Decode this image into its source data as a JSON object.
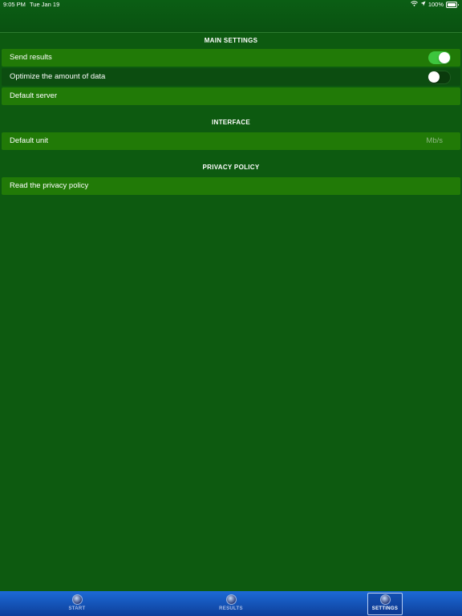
{
  "status_bar": {
    "time": "9:05 PM",
    "date": "Tue Jan 19",
    "battery": "100%"
  },
  "sections": [
    {
      "header": "MAIN SETTINGS",
      "rows": [
        {
          "label": "Send results",
          "toggle": true
        },
        {
          "label": "Optimize the amount of data",
          "toggle": false
        },
        {
          "label": "Default server"
        }
      ]
    },
    {
      "header": "INTERFACE",
      "rows": [
        {
          "label": "Default unit",
          "value": "Mb/s"
        }
      ]
    },
    {
      "header": "PRIVACY POLICY",
      "rows": [
        {
          "label": "Read the privacy policy"
        }
      ]
    }
  ],
  "tab_bar": {
    "tabs": [
      {
        "label": "START",
        "icon": "speedometer-icon"
      },
      {
        "label": "RESULTS",
        "icon": "results-icon"
      },
      {
        "label": "SETTINGS",
        "icon": "globe-icon",
        "active": true
      }
    ]
  },
  "colors": {
    "background": "#0d5a10",
    "row_light": "#217a07",
    "row_dark": "#0c4d10",
    "toggle_on": "#3dc53d",
    "tab_bar": "#1c6ad6"
  }
}
